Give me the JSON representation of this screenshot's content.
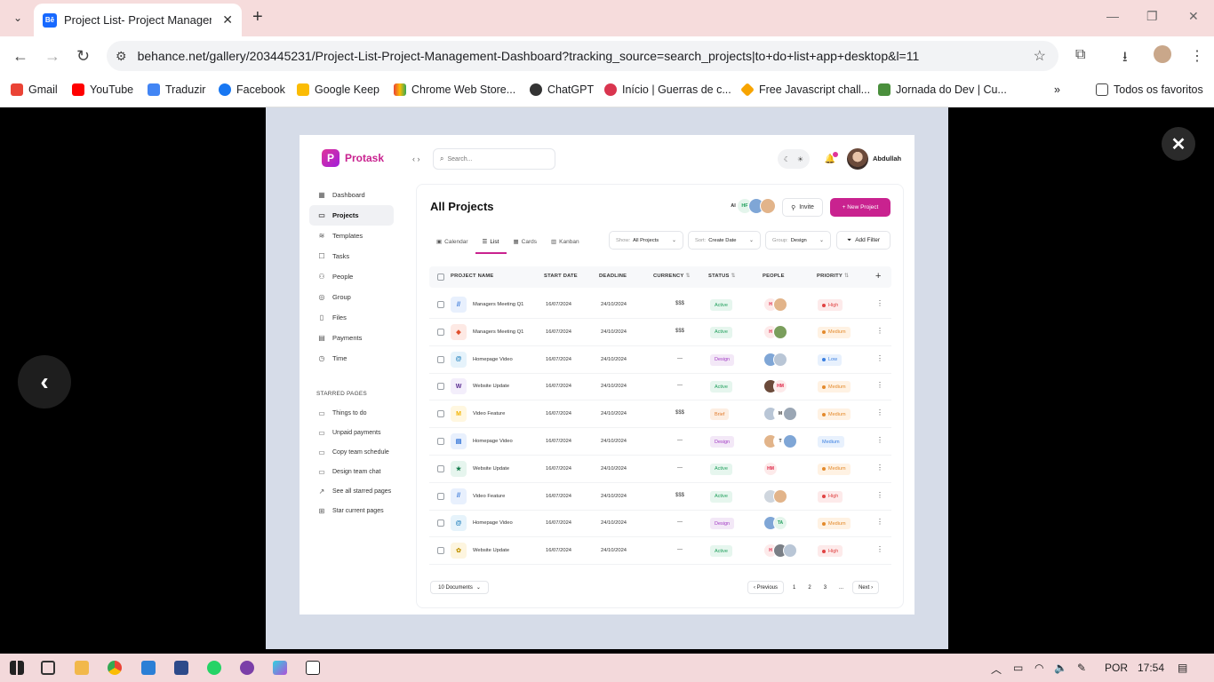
{
  "browser": {
    "tab_title": "Project List- Project Manageme",
    "tab_favicon": "Bē",
    "url": "behance.net/gallery/203445231/Project-List-Project-Management-Dashboard?tracking_source=search_projects|to+do+list+app+desktop&l=11",
    "bookmarks": [
      "Gmail",
      "YouTube",
      "Traduzir",
      "Facebook",
      "Google Keep",
      "Chrome Web Store...",
      "ChatGPT",
      "Início | Guerras de c...",
      "Free Javascript chall...",
      "Jornada do Dev | Cu..."
    ],
    "all_bookmarks": "Todos os favoritos"
  },
  "app": {
    "brand": "Protask",
    "search_placeholder": "Search...",
    "user_name": "Abdullah",
    "sidebar": [
      "Dashboard",
      "Projects",
      "Templates",
      "Tasks",
      "People",
      "Group",
      "Files",
      "Payments",
      "Time"
    ],
    "starred_heading": "STARRED PAGES",
    "starred": [
      "Things to do",
      "Unpaid payments",
      "Copy team schedule",
      "Design team chat",
      "See all starred pages",
      "Star current pages"
    ],
    "page_title": "All Projects",
    "header_avatars": [
      "AI",
      "HF"
    ],
    "invite_label": "Invite",
    "new_project_label": "+ New Project",
    "views": [
      "Calendar",
      "List",
      "Cards",
      "Kanban"
    ],
    "filters": {
      "show_label": "Show:",
      "show_value": "All Projects",
      "sort_label": "Sort:",
      "sort_value": "Create Date",
      "group_label": "Group:",
      "group_value": "Design",
      "add_filter": "Add Filter"
    },
    "columns": [
      "PROJECT NAME",
      "START DATE",
      "DEADLINE",
      "CURRENCY",
      "STATUS",
      "PEOPLE",
      "PRIORITY"
    ],
    "rows": [
      {
        "name": "Managers Meeting Q1",
        "start": "16/07/2024",
        "deadline": "24/10/2024",
        "currency": "$$$",
        "status": "Active",
        "people": "H",
        "priority": "High"
      },
      {
        "name": "Managers Meeting Q1",
        "start": "16/07/2024",
        "deadline": "24/10/2024",
        "currency": "$$$",
        "status": "Active",
        "people": "H",
        "priority": "Medium"
      },
      {
        "name": "Homepage Video",
        "start": "16/07/2024",
        "deadline": "24/10/2024",
        "currency": "---",
        "status": "Design",
        "people": "",
        "priority": "Low"
      },
      {
        "name": "Website Update",
        "start": "16/07/2024",
        "deadline": "24/10/2024",
        "currency": "---",
        "status": "Active",
        "people": "HM",
        "priority": "Medium"
      },
      {
        "name": "Video Feature",
        "start": "16/07/2024",
        "deadline": "24/10/2024",
        "currency": "$$$",
        "status": "Brief",
        "people": "M",
        "priority": "Medium"
      },
      {
        "name": "Homepage Video",
        "start": "16/07/2024",
        "deadline": "24/10/2024",
        "currency": "---",
        "status": "Design",
        "people": "T",
        "priority": "Medium"
      },
      {
        "name": "Website Update",
        "start": "16/07/2024",
        "deadline": "24/10/2024",
        "currency": "---",
        "status": "Active",
        "people": "HM",
        "priority": "Medium"
      },
      {
        "name": "Video Feature",
        "start": "16/07/2024",
        "deadline": "24/10/2024",
        "currency": "$$$",
        "status": "Active",
        "people": "",
        "priority": "High"
      },
      {
        "name": "Homepage Video",
        "start": "16/07/2024",
        "deadline": "24/10/2024",
        "currency": "---",
        "status": "Design",
        "people": "TA",
        "priority": "Medium"
      },
      {
        "name": "Website Update",
        "start": "16/07/2024",
        "deadline": "24/10/2024",
        "currency": "---",
        "status": "Active",
        "people": "H",
        "priority": "High"
      }
    ],
    "docs_label": "10 Documents",
    "pager": {
      "prev": "Previous",
      "pages": [
        "1",
        "2",
        "3",
        "..."
      ],
      "next": "Next"
    }
  },
  "taskbar": {
    "lang": "POR",
    "time": "17:54"
  },
  "colors": {
    "brand": "#c9228f",
    "active": "#1e9e5a",
    "design": "#a23bc4",
    "brief": "#e07b2d",
    "high": "#e04343",
    "medium": "#e38a2c",
    "low": "#3a7fe0"
  }
}
